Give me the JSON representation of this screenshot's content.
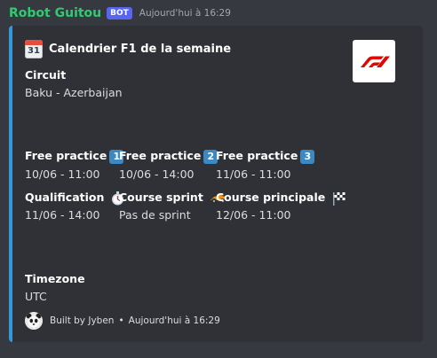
{
  "message": {
    "bot_name": "Robot Guitou",
    "bot_tag": "BOT",
    "timestamp": "Aujourd'hui à 16:29",
    "accent_color": "#3498db"
  },
  "embed": {
    "title": "Calendrier F1 de la semaine",
    "calendar_day": "31",
    "thumbnail_alt": "F1 logo",
    "circuit": {
      "name": "Circuit",
      "value": "Baku - Azerbaijan"
    },
    "sessions": [
      {
        "name": "Free practice",
        "badge": "1",
        "value": "10/06 - 11:00"
      },
      {
        "name": "Free practice",
        "badge": "2",
        "value": "10/06 - 14:00"
      },
      {
        "name": "Free practice",
        "badge": "3",
        "value": "11/06 - 11:00"
      },
      {
        "name": "Qualification",
        "icon": "stopwatch-icon",
        "value": "11/06 - 14:00"
      },
      {
        "name": "Course sprint",
        "icon": "race-car-icon",
        "value": "Pas de sprint"
      },
      {
        "name": "Course principale",
        "icon": "checkered-flag-icon",
        "value": "12/06 - 11:00"
      }
    ],
    "timezone": {
      "name": "Timezone",
      "value": "UTC"
    },
    "footer": {
      "text": "Built by Jyben",
      "separator": "•",
      "timestamp": "Aujourd'hui à 16:29"
    }
  }
}
